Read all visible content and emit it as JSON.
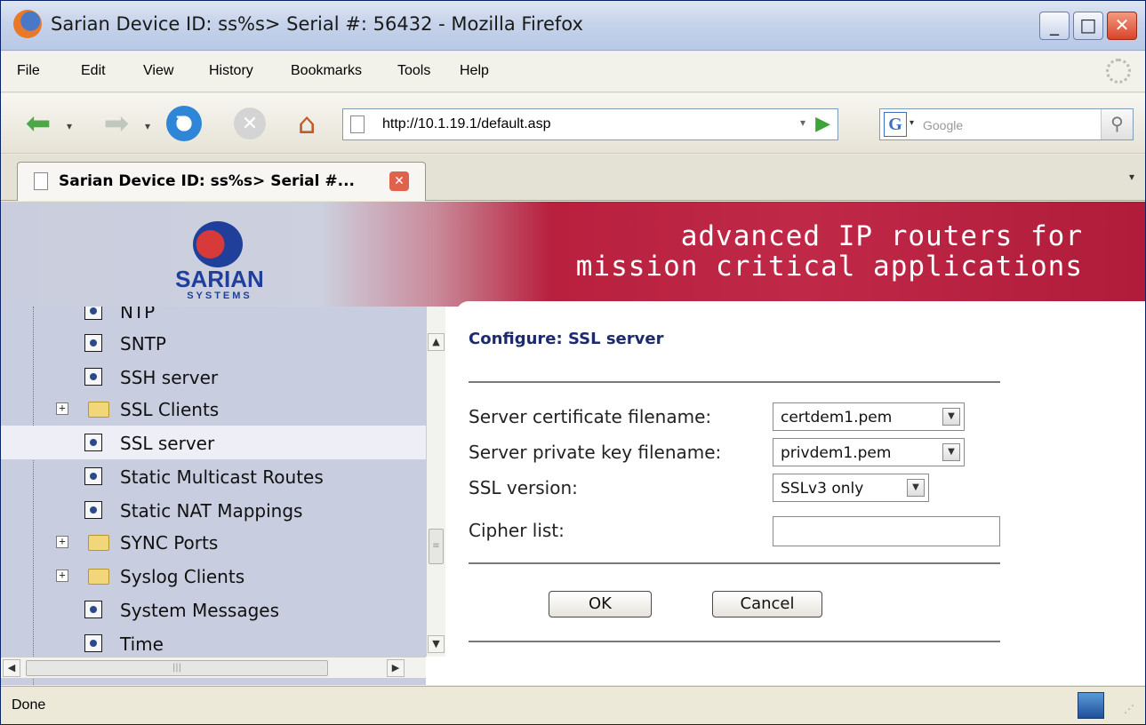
{
  "window": {
    "title": "Sarian Device ID: ss%s> Serial #: 56432 - Mozilla Firefox",
    "minimize": "_",
    "maximize": "□",
    "close": "✕"
  },
  "menu": [
    "File",
    "Edit",
    "View",
    "History",
    "Bookmarks",
    "Tools",
    "Help"
  ],
  "toolbar": {
    "url": "http://10.1.19.1/default.asp",
    "search_placeholder": "Google",
    "search_engine_icon": "G"
  },
  "tab": {
    "title": "Sarian Device ID: ss%s> Serial #...",
    "close": "✕"
  },
  "banner": {
    "logo_name": "SARIAN",
    "logo_sub": "SYSTEMS",
    "tagline_line1": "advanced IP routers for",
    "tagline_line2": "mission critical applications"
  },
  "sidebar": {
    "items": [
      {
        "label": "NTP",
        "type": "doc"
      },
      {
        "label": "SNTP",
        "type": "doc"
      },
      {
        "label": "SSH server",
        "type": "doc"
      },
      {
        "label": "SSL Clients",
        "type": "folder"
      },
      {
        "label": "SSL server",
        "type": "doc",
        "selected": true
      },
      {
        "label": "Static Multicast Routes",
        "type": "doc"
      },
      {
        "label": "Static NAT Mappings",
        "type": "doc"
      },
      {
        "label": "SYNC Ports",
        "type": "folder"
      },
      {
        "label": "Syslog Clients",
        "type": "folder"
      },
      {
        "label": "System Messages",
        "type": "doc"
      },
      {
        "label": "Time",
        "type": "doc"
      }
    ]
  },
  "main": {
    "page_title": "Configure: SSL server",
    "fields": {
      "cert_label": "Server certificate filename:",
      "cert_value": "certdem1.pem",
      "key_label": "Server private key filename:",
      "key_value": "privdem1.pem",
      "version_label": "SSL version:",
      "version_value": "SSLv3 only",
      "cipher_label": "Cipher list:",
      "cipher_value": ""
    },
    "ok_label": "OK",
    "cancel_label": "Cancel"
  },
  "status": {
    "text": "Done"
  }
}
